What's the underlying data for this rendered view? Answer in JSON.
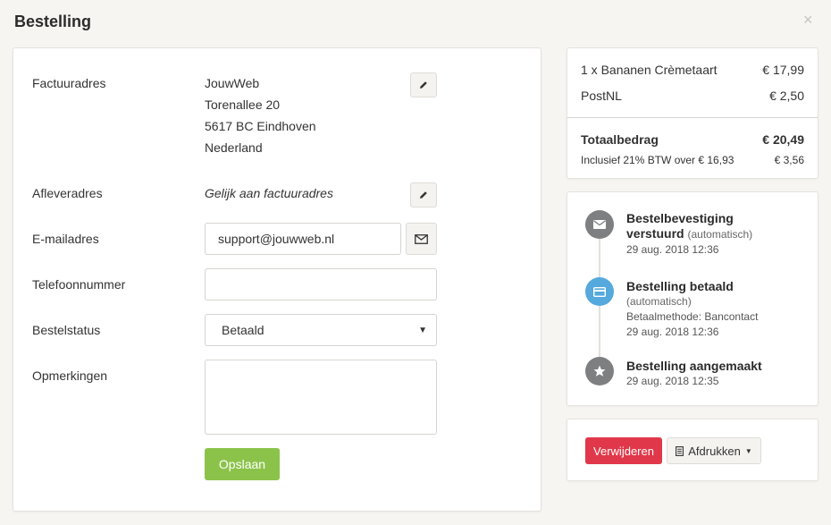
{
  "dialog": {
    "title": "Bestelling",
    "close_glyph": "×"
  },
  "form": {
    "billing": {
      "label": "Factuuradres",
      "lines": [
        "JouwWeb",
        "Torenallee 20",
        "5617 BC Eindhoven",
        "Nederland"
      ]
    },
    "delivery": {
      "label": "Afleveradres",
      "value": "Gelijk aan factuuradres"
    },
    "email": {
      "label": "E-mailadres",
      "value": "support@jouwweb.nl"
    },
    "phone": {
      "label": "Telefoonnummer",
      "value": ""
    },
    "status": {
      "label": "Bestelstatus",
      "selected": "Betaald"
    },
    "notes": {
      "label": "Opmerkingen",
      "value": ""
    },
    "save_label": "Opslaan"
  },
  "summary": {
    "items": [
      {
        "name": "1 x Bananen Crèmetaart",
        "price": "€ 17,99"
      },
      {
        "name": "PostNL",
        "price": "€ 2,50"
      }
    ],
    "total_label": "Totaalbedrag",
    "total_value": "€ 20,49",
    "vat_label": "Inclusief 21% BTW over € 16,93",
    "vat_value": "€ 3,56"
  },
  "timeline": [
    {
      "icon": "envelope-icon",
      "title_a": "Bestelbevestiging",
      "title_b": "verstuurd",
      "auto": "(automatisch)",
      "method": "",
      "date": "29 aug. 2018 12:36"
    },
    {
      "icon": "credit-card-icon",
      "title_a": "Bestelling betaald",
      "title_b": "",
      "auto": "(automatisch)",
      "method": "Betaalmethode: Bancontact",
      "date": "29 aug. 2018 12:36"
    },
    {
      "icon": "star-icon",
      "title_a": "Bestelling aangemaakt",
      "title_b": "",
      "auto": "",
      "method": "",
      "date": "29 aug. 2018 12:35"
    }
  ],
  "actions": {
    "delete_label": "Verwijderen",
    "print_label": "Afdrukken"
  },
  "colors": {
    "save": "#8bc34a",
    "delete": "#e0384a",
    "timeline_blue": "#55a9dd",
    "timeline_grey": "#7d7f81"
  }
}
